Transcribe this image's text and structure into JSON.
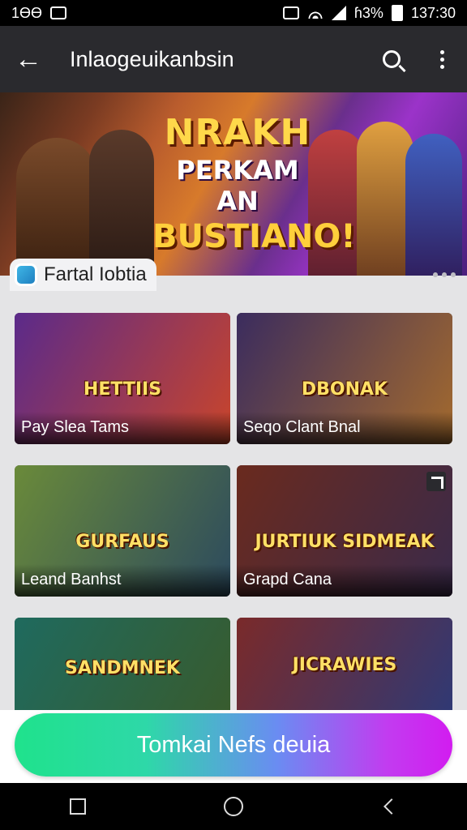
{
  "status_bar": {
    "left_text": "1ӨӨ",
    "time": "137:30",
    "battery": "ɦ3%"
  },
  "app_bar": {
    "title": "Inlaogeuikanbsin",
    "back_icon": "arrow-left-icon",
    "search_icon": "search-icon",
    "menu_icon": "more-vert-icon"
  },
  "hero": {
    "line1": "NRAKH",
    "line2": "PERKAM AN",
    "line3": "BUSTIANO!"
  },
  "section": {
    "label": "Fartal Iobtia"
  },
  "cards": [
    {
      "logo": "HETTIIS",
      "caption": "Pay Slea Tams",
      "colors": [
        "#5b2a8a",
        "#c9452b"
      ]
    },
    {
      "logo": "DBONAK",
      "caption": "Seqo Clant Bnal",
      "colors": [
        "#3b2c5e",
        "#a36a2e"
      ]
    },
    {
      "logo": "GURFAUS",
      "caption": "Leand Banhst",
      "colors": [
        "#6a8a3a",
        "#2c4a5e"
      ]
    },
    {
      "logo": "JURTIUK SIDMEAK",
      "caption": "Grapd Cana",
      "colors": [
        "#6a2a1e",
        "#3a2a4a"
      ]
    },
    {
      "logo": "SANDMNEK",
      "caption": "",
      "colors": [
        "#1f6a5e",
        "#3a5a2a"
      ]
    },
    {
      "logo": "JICRAWIES",
      "caption": "",
      "colors": [
        "#7a2a2a",
        "#2a3a7a"
      ]
    }
  ],
  "cta": {
    "label": "Tomkai Nefs deuia"
  },
  "nav": {
    "recents_icon": "square-icon",
    "home_icon": "circle-icon",
    "back_icon": "triangle-back-icon"
  }
}
